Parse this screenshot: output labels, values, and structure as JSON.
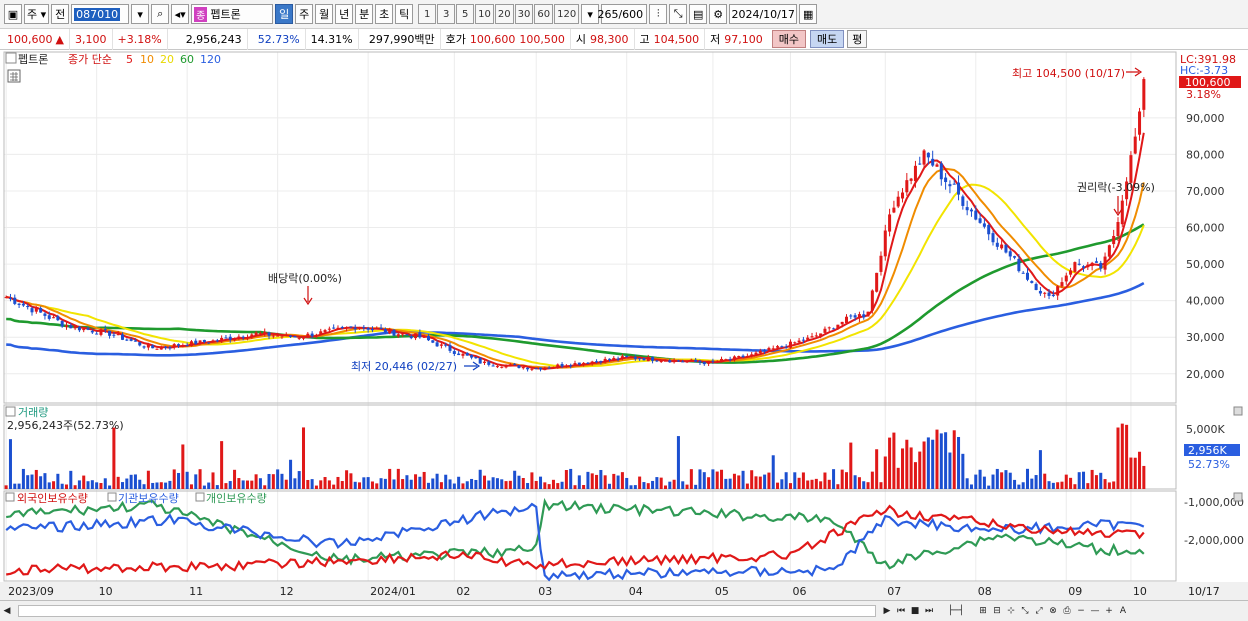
{
  "toolbar": {
    "period_select": "주",
    "compare_select": "전",
    "stock_code": "087010",
    "badge": "종",
    "stock_name": "펩트론",
    "periods": [
      "일",
      "주",
      "월",
      "년",
      "분",
      "초",
      "틱"
    ],
    "active_period": "일",
    "numbers": [
      "1",
      "3",
      "5",
      "10",
      "20",
      "30",
      "60",
      "120"
    ],
    "count": "265/600",
    "date": "2024/10/17"
  },
  "info": {
    "price": "100,600",
    "change": "3,100",
    "change_pct": "+3.18%",
    "volume": "2,956,243",
    "volume_ratio": "52.73%",
    "turnover": "14.31%",
    "amount": "297,990백만",
    "quote_label": "호가",
    "ask": "100,600",
    "bid": "100,500",
    "open_label": "시",
    "open": "98,300",
    "high_label": "고",
    "high": "104,500",
    "low_label": "저",
    "low": "97,100",
    "buy_btn": "매수",
    "sell_btn": "매도",
    "eq_btn": "평"
  },
  "price_panel": {
    "legend_name": "펩트론",
    "legend_close": "종가 단순",
    "ma_labels": [
      "5",
      "10",
      "20",
      "60",
      "120"
    ],
    "lc": "LC:391.98",
    "hc": "HC:-3.73",
    "current": "100,600",
    "current_pct": "3.18%",
    "y_ticks": [
      "90,000",
      "80,000",
      "70,000",
      "60,000",
      "50,000",
      "40,000",
      "30,000",
      "20,000"
    ],
    "annot_high": "최고 104,500 (10/17)",
    "annot_low": "최저 20,446 (02/27)",
    "annot_dividend": "배당락(0.00%)",
    "annot_rights": "권리락(-3.09%)"
  },
  "volume_panel": {
    "title": "거래량",
    "value": "2,956,243주(52.73%)",
    "y_tick": "5,000K",
    "current": "2,956K",
    "current_pct": "52.73%"
  },
  "holdings_panel": {
    "legend": [
      "외국인보유수량",
      "기관보유수량",
      "개인보유수량"
    ],
    "y_ticks": [
      "-1,000,000",
      "-2,000,000"
    ]
  },
  "x_axis": [
    "2023/09",
    "10",
    "11",
    "12",
    "2024/01",
    "02",
    "03",
    "04",
    "05",
    "06",
    "07",
    "08",
    "09",
    "10",
    "10/17"
  ],
  "colors": {
    "up": "#e01818",
    "down": "#1b4fd0",
    "ma5": "#e01818",
    "ma10": "#f08c00",
    "ma20": "#f2e400",
    "ma60": "#1f9a2e",
    "ma120": "#2a5ee0",
    "foreign": "#e01818",
    "institution": "#2a5ee0",
    "individual": "#2f9a55"
  },
  "chart_data": {
    "type": "line",
    "x": [
      "2023/09",
      "10",
      "11",
      "12",
      "2024/01",
      "02",
      "03",
      "04",
      "05",
      "06",
      "07",
      "08",
      "09",
      "10"
    ],
    "series": [
      {
        "name": "종가 단순",
        "values": [
          40000,
          30000,
          28000,
          33000,
          35000,
          24000,
          23000,
          26000,
          27000,
          31000,
          37000,
          80000,
          55000,
          48000,
          100600
        ]
      }
    ],
    "ylim": [
      12000,
      108000
    ],
    "annotations": [
      "최고 104,500 (10/17)",
      "최저 20,446 (02/27)"
    ]
  }
}
